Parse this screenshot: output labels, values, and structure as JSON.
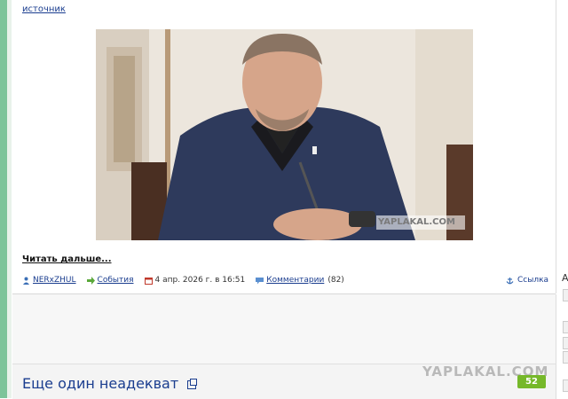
{
  "post": {
    "source_label": "источник",
    "read_more": "Читать дальше...",
    "author": "NERxZHUL",
    "category": "События",
    "date": "4 апр. 2026 г. в 16:51",
    "comments_label": "Комментарии",
    "comments_count": "(82)",
    "permalink_label": "Ссылка",
    "photo_watermark": "YAPLAKAL.COM"
  },
  "next_post": {
    "title": "Еще один неадекват",
    "rating": "52"
  },
  "site_watermark": "YAPLAKAL.COM",
  "sidebar": {
    "letter": "А"
  },
  "colors": {
    "link": "#1a3d8f",
    "badge": "#76b82a",
    "rail": "#7dc49a"
  }
}
